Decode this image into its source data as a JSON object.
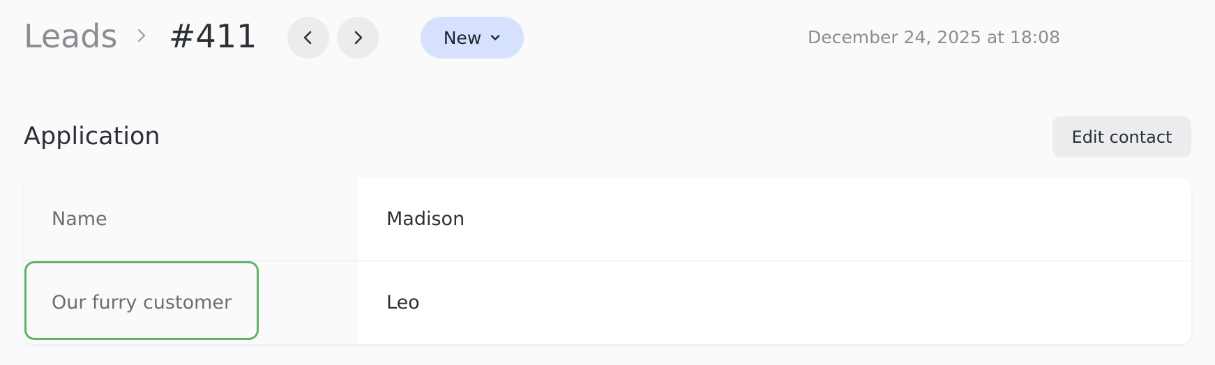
{
  "header": {
    "breadcrumb_root": "Leads",
    "record_id": "#411",
    "status": "New",
    "timestamp": "December 24, 2025 at 18:08"
  },
  "section": {
    "title": "Application",
    "edit_button": "Edit contact"
  },
  "fields": [
    {
      "label": "Name",
      "value": "Madison"
    },
    {
      "label": "Our furry customer",
      "value": "Leo"
    }
  ],
  "colors": {
    "status_pill_bg": "#d6e2fd",
    "highlight_border": "#5fb266",
    "nav_button_bg": "#ececec"
  },
  "icons": {
    "breadcrumb_separator": "chevron-right-icon",
    "prev": "chevron-left-icon",
    "next": "chevron-right-icon",
    "status_dropdown": "chevron-down-icon"
  }
}
